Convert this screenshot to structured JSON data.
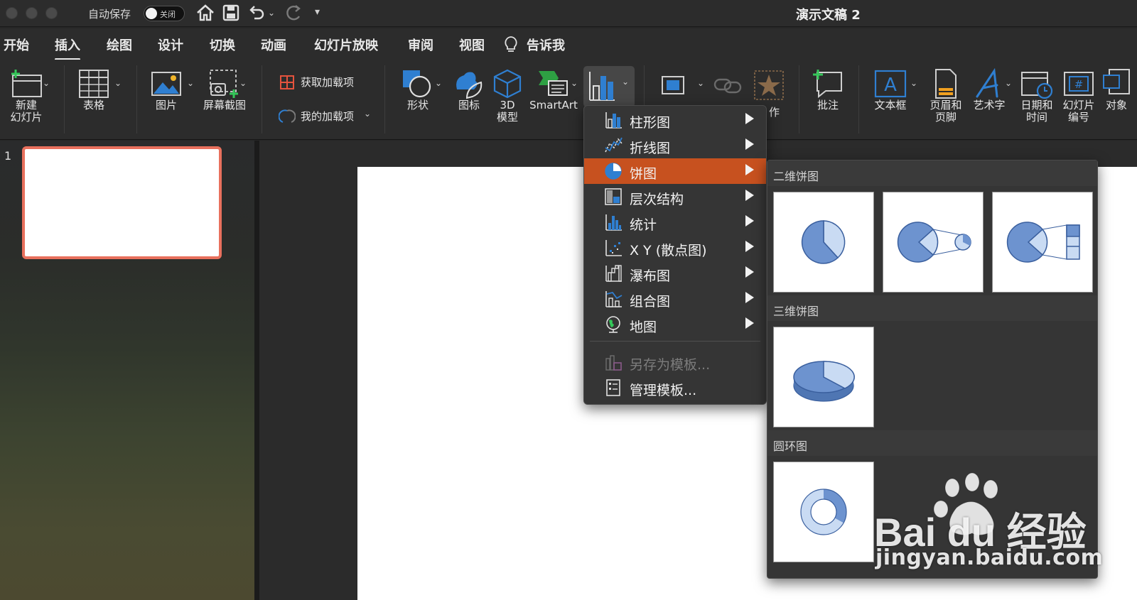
{
  "titlebar": {
    "autosave_label": "自动保存",
    "autosave_state": "关闭",
    "doc_title": "演示文稿 2"
  },
  "tabs": [
    {
      "label": "开始",
      "active": false
    },
    {
      "label": "插入",
      "active": true
    },
    {
      "label": "绘图",
      "active": false
    },
    {
      "label": "设计",
      "active": false
    },
    {
      "label": "切换",
      "active": false
    },
    {
      "label": "动画",
      "active": false
    },
    {
      "label": "幻灯片放映",
      "active": false
    },
    {
      "label": "审阅",
      "active": false
    },
    {
      "label": "视图",
      "active": false
    },
    {
      "label": "告诉我",
      "active": false
    }
  ],
  "ribbon": {
    "new_slide": "新建\n幻灯片",
    "table": "表格",
    "picture": "图片",
    "screenshot": "屏幕截图",
    "get_addins": "获取加载项",
    "my_addins": "我的加载项",
    "shapes": "形状",
    "icons": "图标",
    "model3d": "3D\n模型",
    "smartart": "SmartArt",
    "action_partial": "作",
    "comment": "批注",
    "textbox": "文本框",
    "header_footer": "页眉和\n页脚",
    "wordart": "艺术字",
    "datetime": "日期和\n时间",
    "slide_number": "幻灯片\n编号",
    "object": "对象"
  },
  "slides_panel": {
    "slide_number": "1"
  },
  "chart_menu": {
    "items": [
      {
        "label": "柱形图",
        "icon": "column-chart-icon",
        "submenu": true,
        "highlighted": false,
        "disabled": false
      },
      {
        "label": "折线图",
        "icon": "line-chart-icon",
        "submenu": true,
        "highlighted": false,
        "disabled": false
      },
      {
        "label": "饼图",
        "icon": "pie-chart-icon",
        "submenu": true,
        "highlighted": true,
        "disabled": false
      },
      {
        "label": "层次结构",
        "icon": "hierarchy-chart-icon",
        "submenu": true,
        "highlighted": false,
        "disabled": false
      },
      {
        "label": "统计",
        "icon": "statistic-chart-icon",
        "submenu": true,
        "highlighted": false,
        "disabled": false
      },
      {
        "label": "X Y (散点图)",
        "icon": "scatter-chart-icon",
        "submenu": true,
        "highlighted": false,
        "disabled": false
      },
      {
        "label": "瀑布图",
        "icon": "waterfall-chart-icon",
        "submenu": true,
        "highlighted": false,
        "disabled": false
      },
      {
        "label": "组合图",
        "icon": "combo-chart-icon",
        "submenu": true,
        "highlighted": false,
        "disabled": false
      },
      {
        "label": "地图",
        "icon": "map-chart-icon",
        "submenu": true,
        "highlighted": false,
        "disabled": false
      },
      {
        "label": "另存为模板...",
        "icon": "save-template-icon",
        "submenu": false,
        "highlighted": false,
        "disabled": true
      },
      {
        "label": "管理模板...",
        "icon": "manage-template-icon",
        "submenu": false,
        "highlighted": false,
        "disabled": false
      }
    ]
  },
  "pie_submenu": {
    "sections": [
      {
        "title": "二维饼图",
        "options": [
          "pie",
          "pie-of-pie",
          "bar-of-pie"
        ]
      },
      {
        "title": "三维饼图",
        "options": [
          "3d-pie"
        ]
      },
      {
        "title": "圆环图",
        "options": [
          "doughnut"
        ]
      }
    ]
  },
  "watermark": {
    "brand": "Bai du 经验",
    "url": "jingyan.baidu.com"
  },
  "colors": {
    "highlight": "#c7511f",
    "accent_blue": "#2f7fd1",
    "slide_border": "#e8705d"
  }
}
